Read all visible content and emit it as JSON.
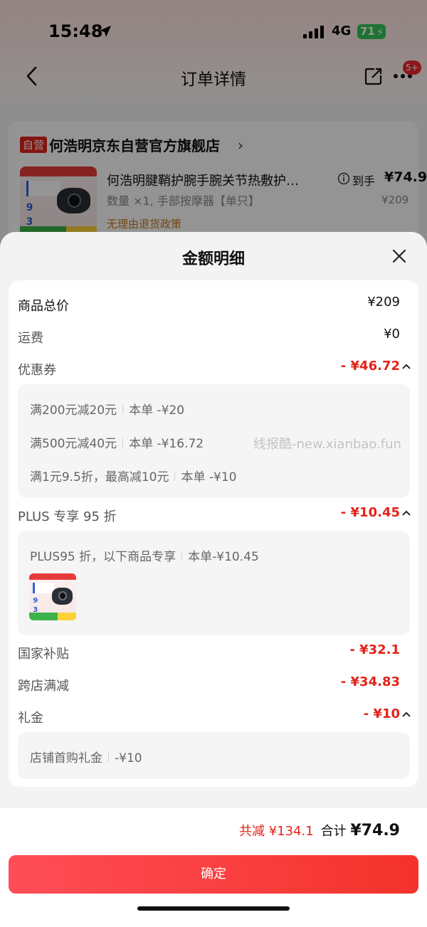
{
  "status_bar": {
    "time": "15:48",
    "network": "4G",
    "battery": "71"
  },
  "header": {
    "title": "订单详情",
    "more_badge": "5+"
  },
  "store": {
    "self_badge": "自营",
    "name": "何浩明京东自营官方旗舰店",
    "product": {
      "name": "何浩明腱鞘护腕手腕关节热敷护…",
      "spec": "数量 ×1, 手部按摩器【单只】",
      "arrive_label": "到手",
      "arrive_price": "¥74.9",
      "original_price": "¥209",
      "policy": "无理由退货政策"
    }
  },
  "sheet": {
    "title": "金额明细",
    "rows": {
      "goods_total": {
        "label": "商品总价",
        "value": "¥209"
      },
      "shipping": {
        "label": "运费",
        "value": "¥0"
      },
      "coupon": {
        "label": "优惠券",
        "value": "- ¥46.72"
      },
      "plus": {
        "label": "PLUS 专享 95 折",
        "value": "- ¥10.45"
      },
      "subsidy": {
        "label": "国家补贴",
        "value": "- ¥32.1"
      },
      "cross_store": {
        "label": "跨店满减",
        "value": "- ¥34.83"
      },
      "gift": {
        "label": "礼金",
        "value": "- ¥10"
      }
    },
    "coupon_details": [
      {
        "name": "满200元减20元",
        "amount": "本单 -¥20"
      },
      {
        "name": "满500元减40元",
        "amount": "本单 -¥16.72"
      },
      {
        "name": "满1元9.5折，最高减10元",
        "amount": "本单 -¥10"
      }
    ],
    "plus_detail": {
      "name": "PLUS95 折，以下商品专享",
      "amount": "本单-¥10.45"
    },
    "gift_detail": {
      "name": "店铺首购礼金",
      "amount": "-¥10"
    },
    "watermark": "线报酷-new.xianbao.fun"
  },
  "footer": {
    "reduce_label": "共减",
    "reduce_value": "¥134.1",
    "total_label": "合计",
    "total_value": "¥74.9",
    "confirm_label": "确定"
  },
  "colors": {
    "accent_red": "#e2231a",
    "button_red": "#f4332b",
    "battery_green": "#34c759"
  }
}
